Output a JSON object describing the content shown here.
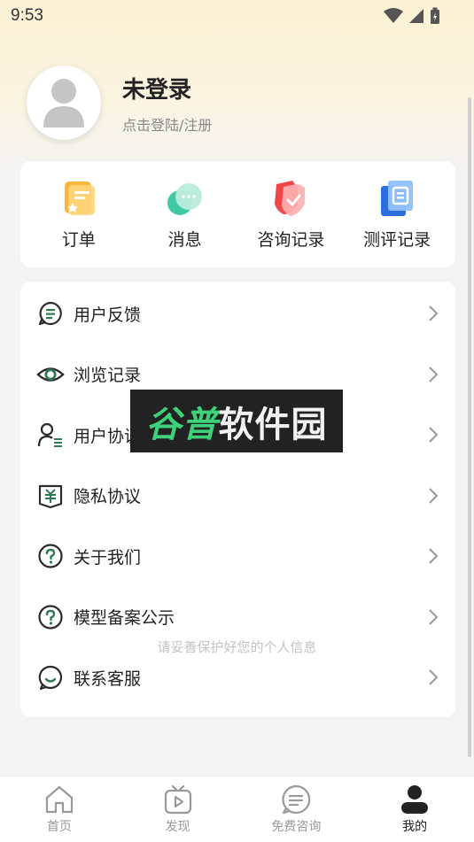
{
  "status_bar": {
    "time": "9:53"
  },
  "profile": {
    "name": "未登录",
    "subtitle": "点击登陆/注册"
  },
  "quick_actions": [
    {
      "label": "订单",
      "icon": "orders-icon"
    },
    {
      "label": "消息",
      "icon": "message-icon"
    },
    {
      "label": "咨询记录",
      "icon": "consult-record-icon"
    },
    {
      "label": "测评记录",
      "icon": "assessment-record-icon"
    }
  ],
  "menu": [
    {
      "label": "用户反馈",
      "icon": "feedback-icon"
    },
    {
      "label": "浏览记录",
      "icon": "eye-icon"
    },
    {
      "label": "用户协议",
      "icon": "user-agreement-icon"
    },
    {
      "label": "隐私协议",
      "icon": "privacy-icon"
    },
    {
      "label": "关于我们",
      "icon": "question-icon"
    },
    {
      "label": "模型备案公示",
      "icon": "question-icon"
    },
    {
      "label": "联系客服",
      "icon": "customer-service-icon"
    }
  ],
  "privacy_tip": "请妥善保护好您的个人信息",
  "watermark": {
    "part1": "谷普",
    "part2": "软件园"
  },
  "tabs": [
    {
      "label": "首页",
      "icon": "home-icon",
      "active": false
    },
    {
      "label": "发现",
      "icon": "discover-tv-icon",
      "active": false
    },
    {
      "label": "免费咨询",
      "icon": "chat-icon",
      "active": false
    },
    {
      "label": "我的",
      "icon": "profile-icon",
      "active": true
    }
  ],
  "colors": {
    "accent_green": "#2f7a52",
    "header_bg": "#fbf1d4",
    "watermark_green": "#3dd17a"
  }
}
